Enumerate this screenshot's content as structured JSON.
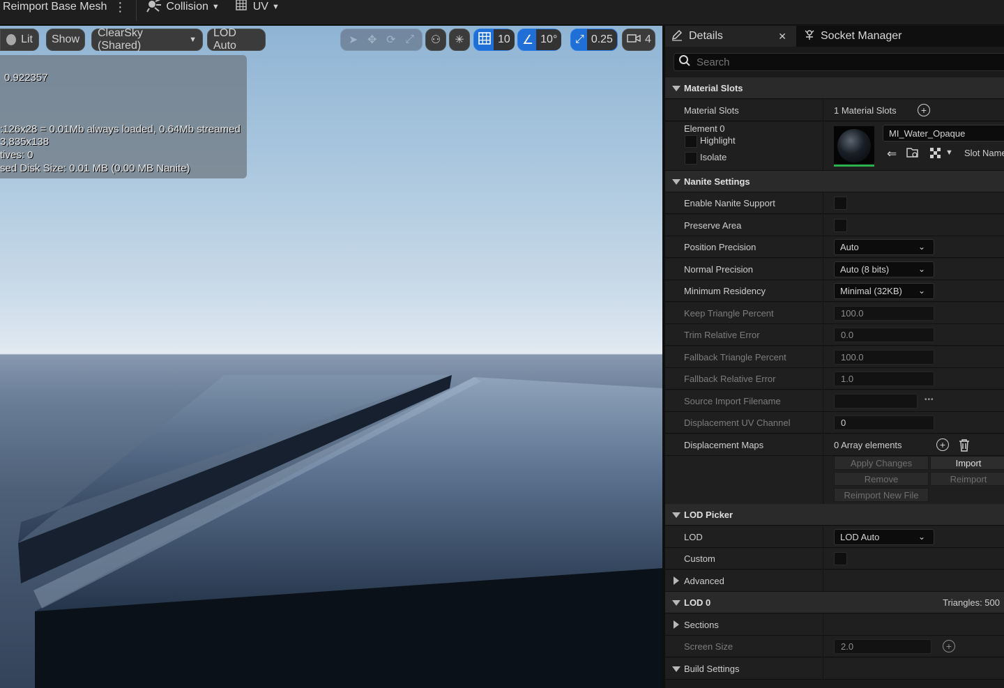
{
  "topbar": {
    "reimport_label": "Reimport Base Mesh",
    "collision_label": "Collision",
    "uv_label": "UV"
  },
  "viewport": {
    "lit_label": "Lit",
    "show_label": "Show",
    "sky_label": "ClearSky (Shared)",
    "lod_label": "LOD Auto",
    "grid_snap": "10",
    "angle_snap": "10°",
    "scale_snap": "0.25",
    "camera_speed": "4",
    "stats": [
      "0.922357",
      ":126x28 = 0.01Mb always loaded, 0.64Mb streamed",
      "3,835x138",
      "tives:  0",
      "sed Disk Size: 0.01 MB (0.00 MB Nanite)"
    ]
  },
  "details": {
    "tab_details": "Details",
    "tab_socket": "Socket Manager",
    "search_placeholder": "Search",
    "material_slots": {
      "header": "Material Slots",
      "label": "Material Slots",
      "count": "1 Material Slots",
      "element": "Element 0",
      "highlight": "Highlight",
      "isolate": "Isolate",
      "material_name": "MI_Water_Opaque",
      "slot_name": "Slot Name"
    },
    "nanite": {
      "header": "Nanite Settings",
      "enable": "Enable Nanite Support",
      "preserve_area": "Preserve Area",
      "position_precision": "Position Precision",
      "position_precision_value": "Auto",
      "normal_precision": "Normal Precision",
      "normal_precision_value": "Auto (8 bits)",
      "min_residency": "Minimum Residency",
      "min_residency_value": "Minimal (32KB)",
      "keep_triangle": "Keep Triangle Percent",
      "keep_triangle_value": "100.0",
      "trim_error": "Trim Relative Error",
      "trim_error_value": "0.0",
      "fallback_triangle": "Fallback Triangle Percent",
      "fallback_triangle_value": "100.0",
      "fallback_error": "Fallback Relative Error",
      "fallback_error_value": "1.0",
      "source_filename": "Source Import Filename",
      "source_filename_more": "•••",
      "displacement_uv": "Displacement UV Channel",
      "displacement_uv_value": "0",
      "displacement_maps": "Displacement Maps",
      "displacement_maps_value": "0 Array elements",
      "apply_changes": "Apply Changes",
      "import": "Import",
      "remove": "Remove",
      "reimport": "Reimport",
      "reimport_new": "Reimport New File"
    },
    "lod_picker": {
      "header": "LOD Picker",
      "lod": "LOD",
      "lod_value": "LOD Auto",
      "custom": "Custom",
      "advanced": "Advanced"
    },
    "lod0": {
      "header": "LOD 0",
      "triangles": "Triangles: 500",
      "sections": "Sections",
      "screen_size": "Screen Size",
      "screen_size_value": "2.0"
    },
    "build_settings": {
      "header": "Build Settings"
    }
  }
}
